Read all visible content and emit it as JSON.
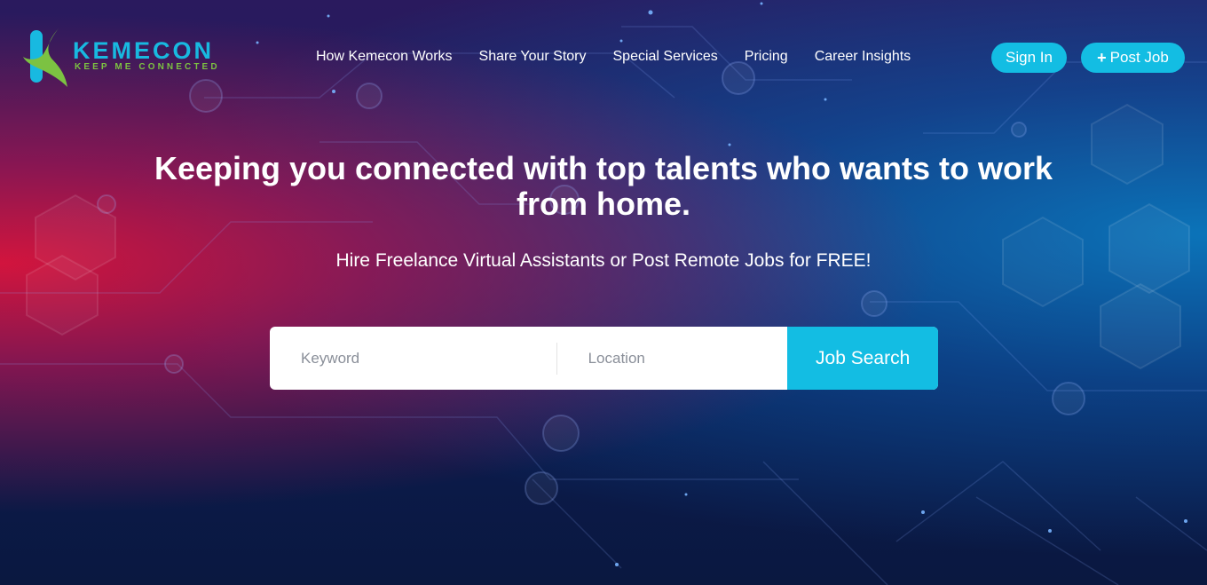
{
  "brand": {
    "name": "KEMECON",
    "tagline": "KEEP ME CONNECTED",
    "colors": {
      "primary": "#18b9e0",
      "secondary": "#7cc242"
    }
  },
  "nav": {
    "items": [
      {
        "label": "How Kemecon Works"
      },
      {
        "label": "Share Your Story"
      },
      {
        "label": "Special Services"
      },
      {
        "label": "Pricing"
      },
      {
        "label": "Career Insights"
      }
    ]
  },
  "auth": {
    "signin_label": "Sign In",
    "post_job_label": "Post Job",
    "post_job_icon": "plus-icon"
  },
  "hero": {
    "headline": "Keeping you connected with top talents who wants to work from home.",
    "subline": "Hire Freelance Virtual Assistants or Post Remote Jobs for FREE!"
  },
  "search": {
    "keyword_placeholder": "Keyword",
    "location_placeholder": "Location",
    "button_label": "Job Search"
  },
  "theme": {
    "accent": "#13bde3",
    "background_left": "#dc143c",
    "background_right": "#0a78be"
  }
}
